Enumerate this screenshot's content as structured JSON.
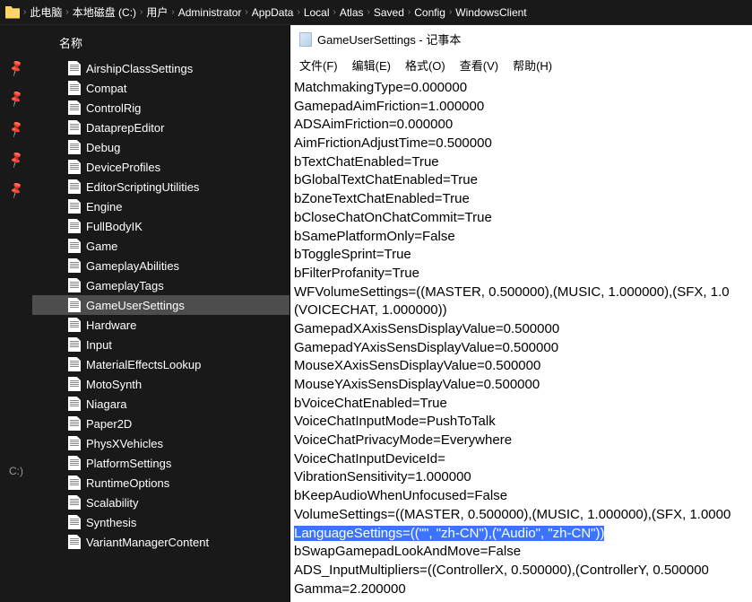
{
  "breadcrumb": [
    "此电脑",
    "本地磁盘 (C:)",
    "用户",
    "Administrator",
    "AppData",
    "Local",
    "Atlas",
    "Saved",
    "Config",
    "WindowsClient"
  ],
  "sidebar": {
    "header": "名称",
    "drive_short": "C:)",
    "files": [
      "AirshipClassSettings",
      "Compat",
      "ControlRig",
      "DataprepEditor",
      "Debug",
      "DeviceProfiles",
      "EditorScriptingUtilities",
      "Engine",
      "FullBodyIK",
      "Game",
      "GameplayAbilities",
      "GameplayTags",
      "GameUserSettings",
      "Hardware",
      "Input",
      "MaterialEffectsLookup",
      "MotoSynth",
      "Niagara",
      "Paper2D",
      "PhysXVehicles",
      "PlatformSettings",
      "RuntimeOptions",
      "Scalability",
      "Synthesis",
      "VariantManagerContent"
    ],
    "selected": "GameUserSettings"
  },
  "editor": {
    "title": "GameUserSettings - 记事本",
    "menu": [
      "文件(F)",
      "编辑(E)",
      "格式(O)",
      "查看(V)",
      "帮助(H)"
    ],
    "lines": [
      "MatchmakingType=0.000000",
      "GamepadAimFriction=1.000000",
      "ADSAimFriction=0.000000",
      "AimFrictionAdjustTime=0.500000",
      "bTextChatEnabled=True",
      "bGlobalTextChatEnabled=True",
      "bZoneTextChatEnabled=True",
      "bCloseChatOnChatCommit=True",
      "bSamePlatformOnly=False",
      "bToggleSprint=True",
      "bFilterProfanity=True",
      "WFVolumeSettings=((MASTER, 0.500000),(MUSIC, 1.000000),(SFX, 1.0",
      "(VOICECHAT, 1.000000))",
      "GamepadXAxisSensDisplayValue=0.500000",
      "GamepadYAxisSensDisplayValue=0.500000",
      "MouseXAxisSensDisplayValue=0.500000",
      "MouseYAxisSensDisplayValue=0.500000",
      "bVoiceChatEnabled=True",
      "VoiceChatInputMode=PushToTalk",
      "VoiceChatPrivacyMode=Everywhere",
      "VoiceChatInputDeviceId=",
      "VibrationSensitivity=1.000000",
      "bKeepAudioWhenUnfocused=False",
      "VolumeSettings=((MASTER, 0.500000),(MUSIC, 1.000000),(SFX, 1.0000",
      "LanguageSettings=((\"\", \"zh-CN\"),(\"Audio\", \"zh-CN\"))",
      "bSwapGamepadLookAndMove=False",
      "ADS_InputMultipliers=((ControllerX, 0.500000),(ControllerY, 0.500000",
      "Gamma=2.200000"
    ],
    "highlighted_line": "LanguageSettings=((\"\", \"zh-CN\"),(\"Audio\", \"zh-CN\"))"
  }
}
